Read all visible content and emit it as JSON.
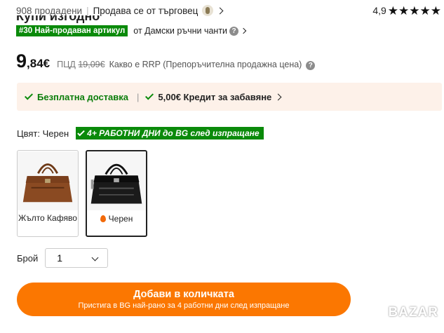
{
  "header": {
    "sold": "908 продадени",
    "seller": "Продава се от търговец",
    "rating": "4,9",
    "stars": "★★★★★",
    "title_partial": "Купи изгодно"
  },
  "bestseller": {
    "badge": "#30 Най-продаван артикул",
    "category": "от Дамски ръчни чанти"
  },
  "price": {
    "integer": "9",
    "decimal": ",84",
    "currency": "€",
    "rrp_label": "ПЦД",
    "rrp_value": "19,09€",
    "rrp_info": "Какво е RRP (Препоръчителна продажна цена)"
  },
  "promo": {
    "free_shipping": "Безплатна доставка",
    "credit": "5,00€ Кредит за забавяне"
  },
  "color": {
    "label": "Цвят: Черен",
    "shipping_badge": "4+ РАБОТНИ ДНИ до BG след изпращане",
    "options": [
      {
        "label": "Жълто Кафяво",
        "color": "#8a4a22"
      },
      {
        "label": "Черен",
        "color": "#1a1a1a"
      }
    ]
  },
  "quantity": {
    "label": "Брой",
    "value": "1"
  },
  "cart": {
    "label": "Добави в количката",
    "sub": "Пристига в BG най-рано за 4 работни дни след изпращане"
  },
  "colors": {
    "accent": "#fb7701",
    "green": "#0a8a0a",
    "promo_bg": "#fdf1e9"
  },
  "watermark": "BAZAR"
}
